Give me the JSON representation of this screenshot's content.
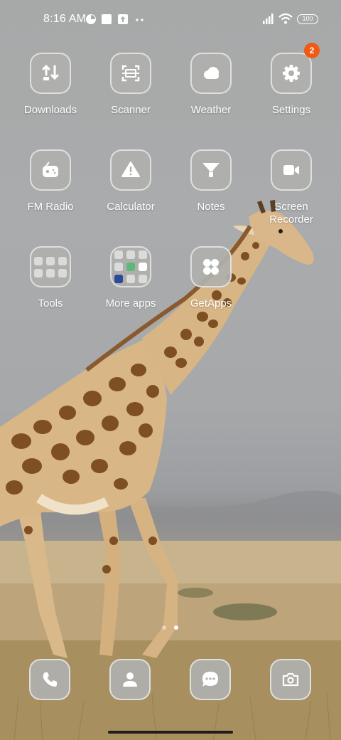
{
  "status_bar": {
    "time": "8:16 AM",
    "battery": "100",
    "icons": [
      "data-saver-icon",
      "square-notification-icon",
      "upload-notification-icon",
      "more-dots-icon",
      "signal-icon",
      "wifi-icon",
      "battery-icon"
    ]
  },
  "apps": [
    {
      "label": "Downloads",
      "icon": "download-icon"
    },
    {
      "label": "Scanner",
      "icon": "scanner-icon"
    },
    {
      "label": "Weather",
      "icon": "cloud-icon"
    },
    {
      "label": "Settings",
      "icon": "gear-icon",
      "badge": "2"
    },
    {
      "label": "FM Radio",
      "icon": "radio-icon"
    },
    {
      "label": "Calculator",
      "icon": "warning-triangle-icon"
    },
    {
      "label": "Notes",
      "icon": "funnel-icon"
    },
    {
      "label": "Screen Recorder",
      "icon": "video-camera-icon"
    },
    {
      "label": "Tools",
      "icon": "folder-icon"
    },
    {
      "label": "More apps",
      "icon": "folder-icon"
    },
    {
      "label": "GetApps",
      "icon": "four-circles-icon"
    }
  ],
  "page_indicator": {
    "pages": 2,
    "active": 2
  },
  "dock": [
    {
      "icon": "phone-icon"
    },
    {
      "icon": "contacts-icon"
    },
    {
      "icon": "messages-icon"
    },
    {
      "icon": "camera-icon"
    }
  ],
  "colors": {
    "badge": "#f05a14",
    "label": "#ffffff",
    "tile": "#b0b0ae"
  }
}
